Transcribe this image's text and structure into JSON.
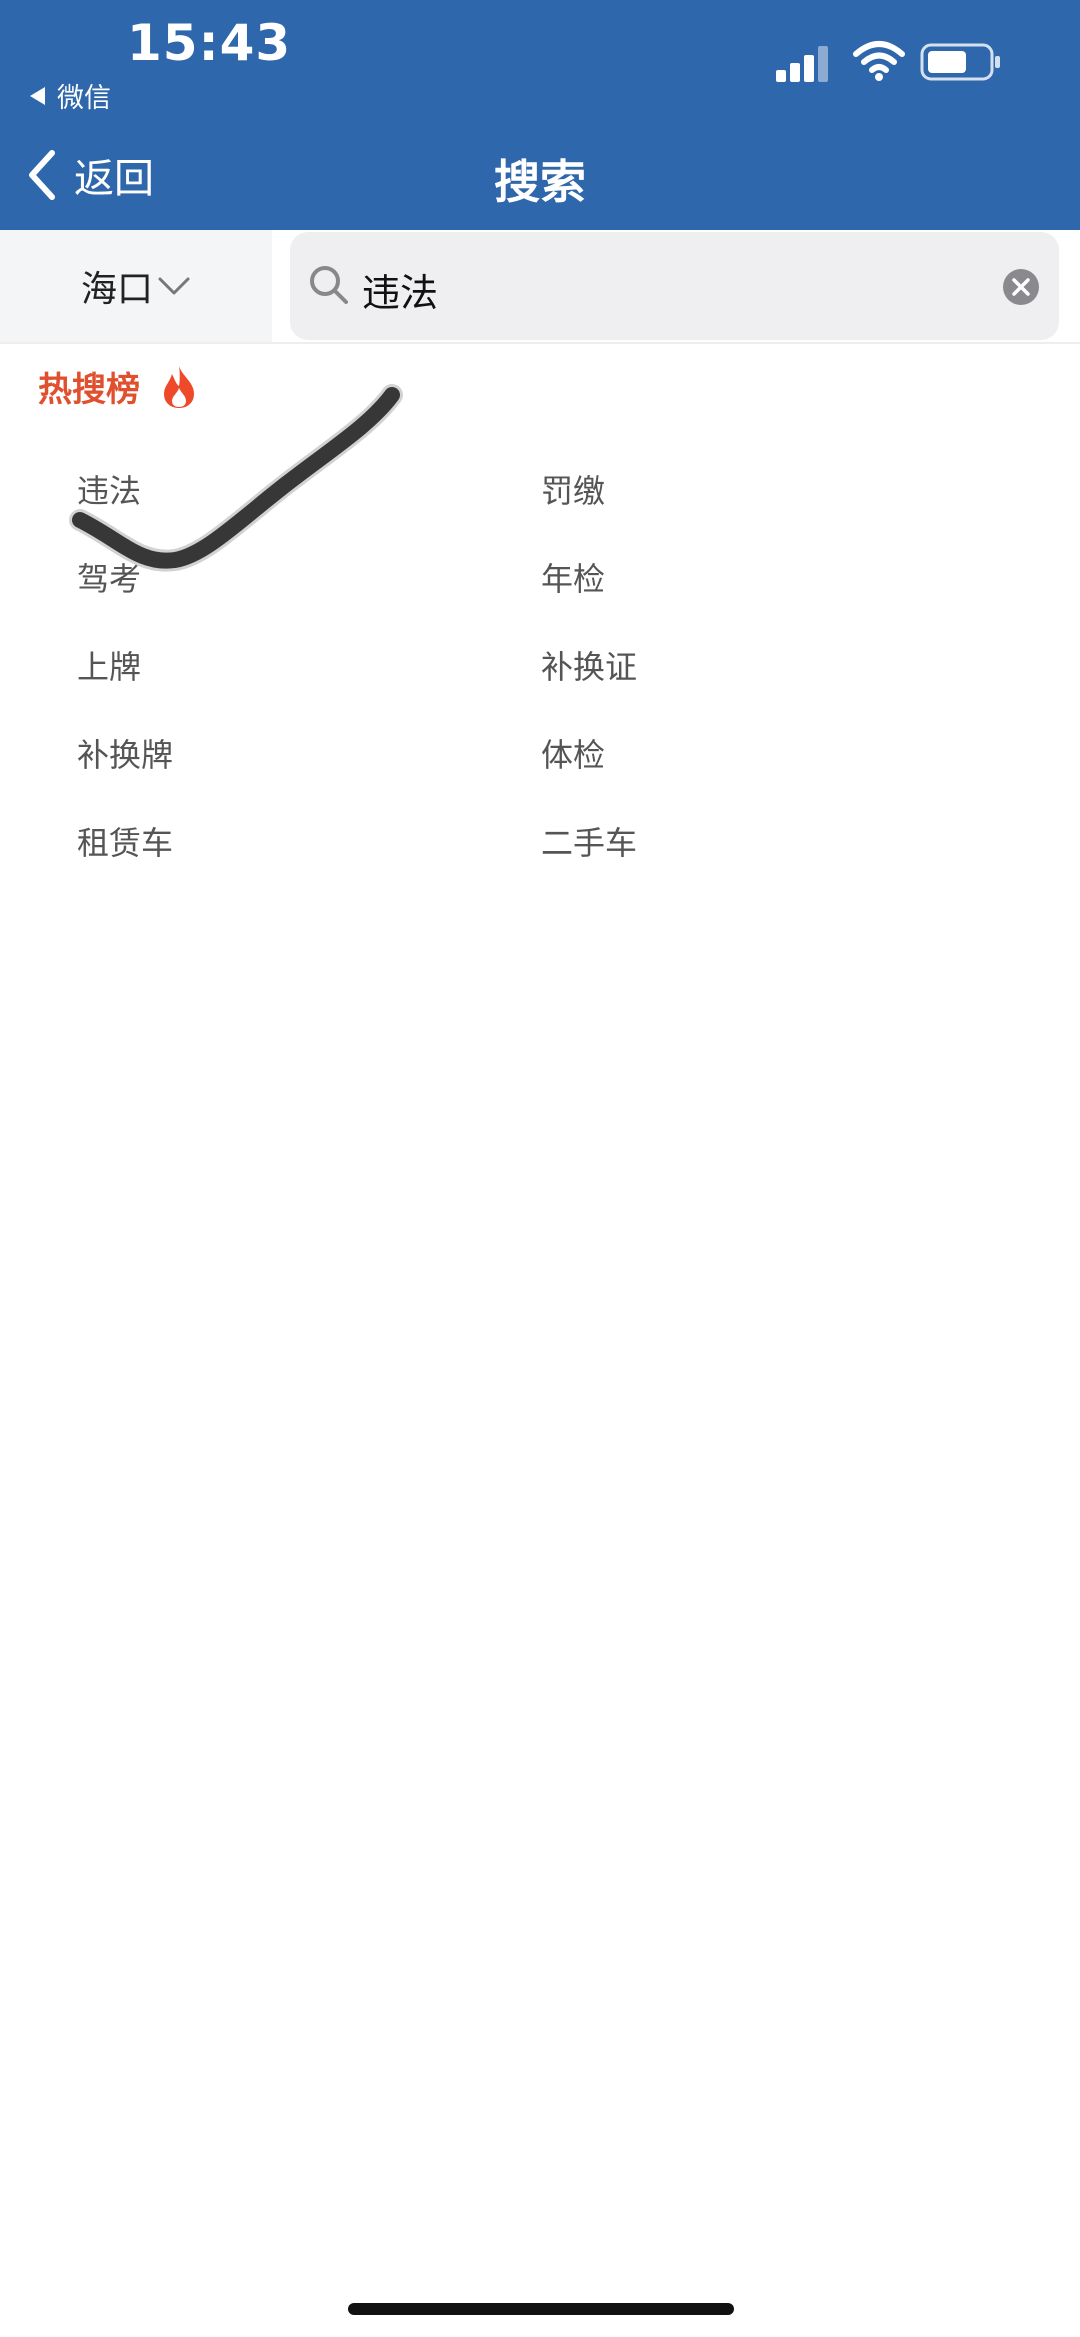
{
  "status_bar": {
    "time": "15:43",
    "back_app_label": "微信",
    "icons": [
      "signal-icon",
      "wifi-icon",
      "battery-icon"
    ]
  },
  "nav": {
    "back_label": "返回",
    "title": "搜索"
  },
  "search": {
    "city": "海口",
    "value": "违法",
    "icons": [
      "chevron-down-icon",
      "search-icon",
      "clear-icon"
    ]
  },
  "hot": {
    "title": "热搜榜",
    "icon": "fire-icon",
    "items": [
      {
        "label": "违法"
      },
      {
        "label": "罚缴"
      },
      {
        "label": "驾考"
      },
      {
        "label": "年检"
      },
      {
        "label": "上牌"
      },
      {
        "label": "补换证"
      },
      {
        "label": "补换牌"
      },
      {
        "label": "体检"
      },
      {
        "label": "租赁车"
      },
      {
        "label": "二手车"
      }
    ]
  },
  "colors": {
    "header_bg": "#2e67ab",
    "hot_title": "#e0502f",
    "city_bg": "#f3f5f7",
    "search_bg": "#efeff1"
  }
}
